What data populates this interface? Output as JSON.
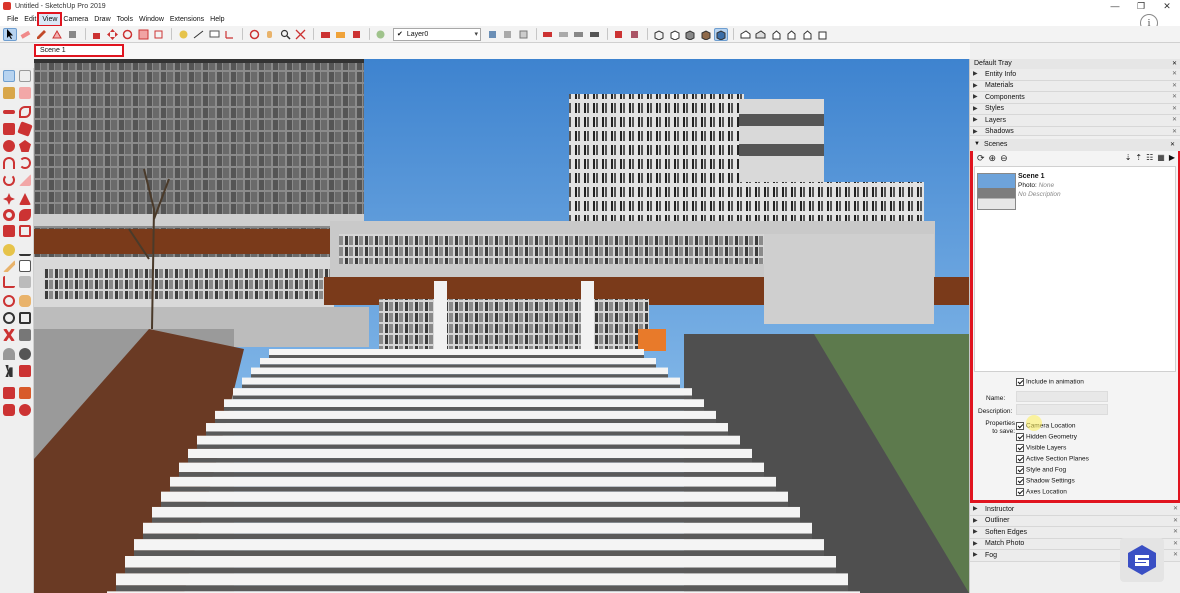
{
  "window": {
    "title": "Untitled - SketchUp Pro 2019",
    "controls": [
      "—",
      "❐",
      "✕"
    ]
  },
  "menubar": {
    "items": [
      {
        "label": "File"
      },
      {
        "label": "Edit"
      },
      {
        "label": "View",
        "active": true
      },
      {
        "label": "Camera"
      },
      {
        "label": "Draw"
      },
      {
        "label": "Tools"
      },
      {
        "label": "Window"
      },
      {
        "label": "Extensions"
      },
      {
        "label": "Help"
      }
    ]
  },
  "toolbar": {
    "layer_check": "✔",
    "layer_value": "Layer0",
    "info_glyph": "i"
  },
  "scene_tabs": [
    {
      "label": "Scene 1"
    }
  ],
  "tray": {
    "title": "Default Tray",
    "upper_panels": [
      "Entity Info",
      "Materials",
      "Components",
      "Styles",
      "Layers",
      "Shadows"
    ],
    "scenes": {
      "title": "Scenes",
      "list": [
        {
          "name": "Scene 1",
          "photo_label": "Photo:",
          "photo_value": "None",
          "description": "No Description"
        }
      ],
      "include_in_animation": "Include in animation",
      "name_label": "Name:",
      "description_label": "Description:",
      "properties_label_1": "Properties",
      "properties_label_2": "to save:",
      "properties": [
        "Camera Location",
        "Hidden Geometry",
        "Visible Layers",
        "Active Section Planes",
        "Style and Fog",
        "Shadow Settings",
        "Axes Location"
      ]
    },
    "lower_panels": [
      "Instructor",
      "Outliner",
      "Soften Edges",
      "Match Photo",
      "Fog"
    ]
  },
  "colors": {
    "highlight": "#e0141f",
    "sky": "#4f8ed1",
    "accent": "#6e9ed0"
  }
}
